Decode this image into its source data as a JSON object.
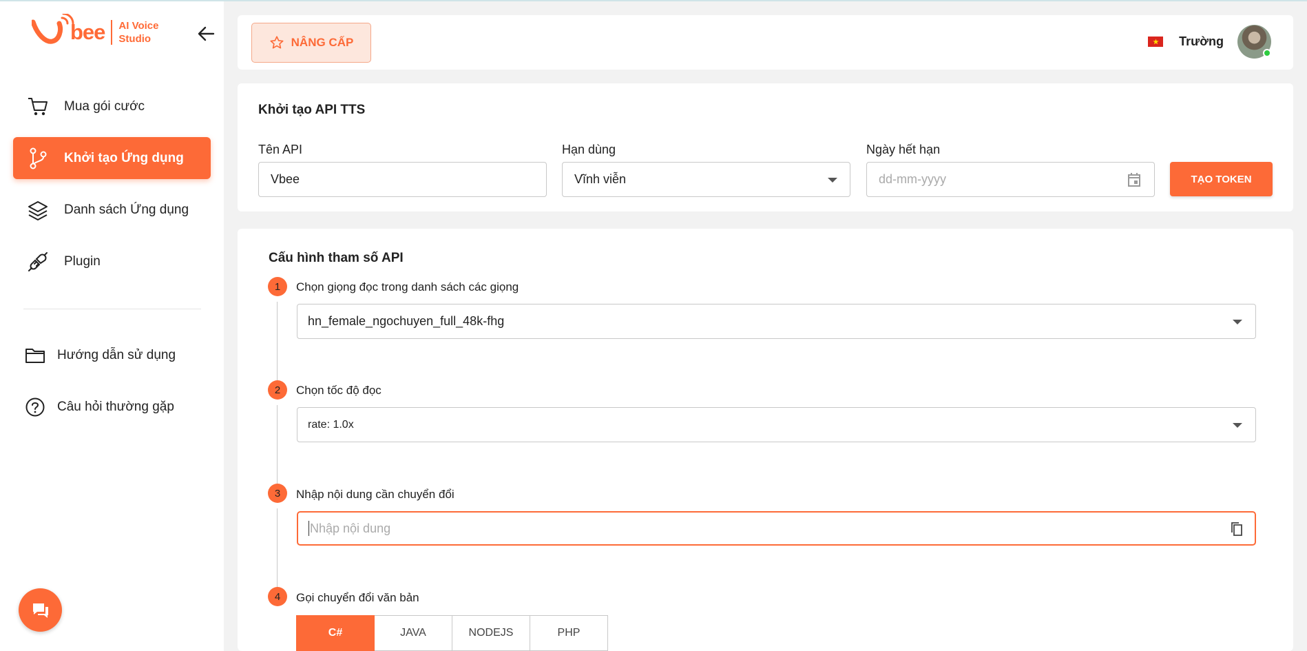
{
  "brand": {
    "logo_word": "bee",
    "tagline_line1": "AI Voice",
    "tagline_line2": "Studio"
  },
  "sidebar": {
    "items": [
      {
        "label": "Mua gói cước",
        "icon": "cart-icon"
      },
      {
        "label": "Khởi tạo Ứng dụng",
        "icon": "branch-icon",
        "active": true
      },
      {
        "label": "Danh sách Ứng dụng",
        "icon": "layers-icon"
      },
      {
        "label": "Plugin",
        "icon": "plug-icon"
      }
    ],
    "secondary": [
      {
        "label": "Hướng dẫn sử dụng",
        "icon": "folder-icon"
      },
      {
        "label": "Câu hỏi thường gặp",
        "icon": "help-circle-icon"
      }
    ]
  },
  "header": {
    "upgrade_label": "NÂNG CẤP",
    "user_name": "Trường",
    "flag": "vietnam-flag-icon"
  },
  "create_api": {
    "title": "Khởi tạo API TTS",
    "name_label": "Tên API",
    "name_value": "Vbee",
    "duration_label": "Hạn dùng",
    "duration_value": "Vĩnh viễn",
    "expiry_label": "Ngày hết hạn",
    "expiry_placeholder": "dd-mm-yyyy",
    "token_button": "TẠO TOKEN"
  },
  "config": {
    "title": "Cấu hình tham số API",
    "steps": [
      {
        "num": "1",
        "title": "Chọn giọng đọc trong danh sách các giọng",
        "value": "hn_female_ngochuyen_full_48k-fhg"
      },
      {
        "num": "2",
        "title": "Chọn tốc độ đọc",
        "value": "rate: 1.0x"
      },
      {
        "num": "3",
        "title": "Nhập nội dung cần chuyển đổi",
        "placeholder": "Nhập nội dung"
      },
      {
        "num": "4",
        "title": "Gọi chuyển đổi văn bản"
      }
    ],
    "tabs": [
      "C#",
      "JAVA",
      "NODEJS",
      "PHP"
    ],
    "active_tab": "C#"
  },
  "colors": {
    "accent": "#fd6a37",
    "accent_light": "#fde7dd",
    "background": "#f2f2f2"
  }
}
